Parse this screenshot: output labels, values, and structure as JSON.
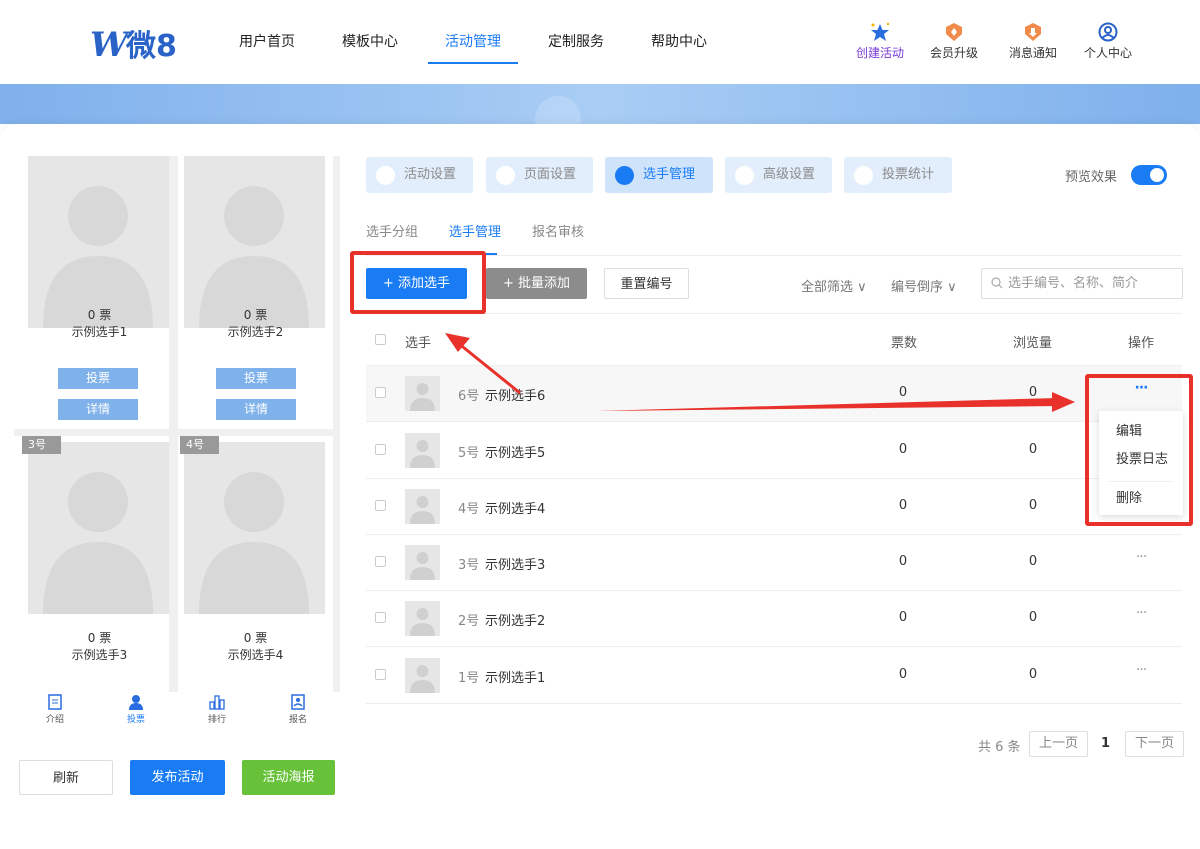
{
  "header": {
    "logo": "W微8",
    "nav": [
      "用户首页",
      "模板中心",
      "活动管理",
      "定制服务",
      "帮助中心"
    ],
    "icons": [
      {
        "label": "创建活动",
        "icon": "stars-icon"
      },
      {
        "label": "会员升级",
        "icon": "badge-icon"
      },
      {
        "label": "消息通知",
        "icon": "bell-badge-icon"
      },
      {
        "label": "个人中心",
        "icon": "user-circle-icon"
      }
    ]
  },
  "preview": {
    "cards": [
      {
        "votes": "0 票",
        "name": "示例选手1",
        "vote_btn": "投票",
        "detail_btn": "详情"
      },
      {
        "votes": "0 票",
        "name": "示例选手2",
        "vote_btn": "投票",
        "detail_btn": "详情"
      },
      {
        "tag": "3号",
        "votes": "0 票",
        "name": "示例选手3"
      },
      {
        "tag": "4号",
        "votes": "0 票",
        "name": "示例选手4"
      }
    ],
    "tabbar": [
      "介绍",
      "投票",
      "排行",
      "报名"
    ],
    "buttons": {
      "refresh": "刷新",
      "publish": "发布活动",
      "poster": "活动海报"
    }
  },
  "settings_tabs": [
    "活动设置",
    "页面设置",
    "选手管理",
    "高级设置",
    "投票统计"
  ],
  "preview_toggle": {
    "label": "预览效果",
    "on": true
  },
  "sub_tabs": [
    "选手分组",
    "选手管理",
    "报名审核"
  ],
  "toolbar": {
    "add": "+ 添加选手",
    "batch": "+ 批量添加",
    "renumber": "重置编号",
    "filter_all": "全部筛选 ∨",
    "sort": "编号倒序 ∨",
    "search_placeholder": "选手编号、名称、简介"
  },
  "table": {
    "headers": {
      "player": "选手",
      "votes": "票数",
      "views": "浏览量",
      "actions": "操作"
    },
    "rows": [
      {
        "num": "6号",
        "name": "示例选手6",
        "votes": "0",
        "views": "0"
      },
      {
        "num": "5号",
        "name": "示例选手5",
        "votes": "0",
        "views": "0"
      },
      {
        "num": "4号",
        "name": "示例选手4",
        "votes": "0",
        "views": "0"
      },
      {
        "num": "3号",
        "name": "示例选手3",
        "votes": "0",
        "views": "0"
      },
      {
        "num": "2号",
        "name": "示例选手2",
        "votes": "0",
        "views": "0"
      },
      {
        "num": "1号",
        "name": "示例选手1",
        "votes": "0",
        "views": "0"
      }
    ],
    "more": "···"
  },
  "row_menu": {
    "edit": "编辑",
    "vote_log": "投票日志",
    "delete": "删除"
  },
  "pagination": {
    "total": "共 6 条",
    "prev": "上一页",
    "current": "1",
    "next": "下一页"
  },
  "colors": {
    "accent": "#1a7cf5",
    "annotation": "#e8312a",
    "poster": "#67c23a",
    "preview_btn": "#7fb1ea"
  }
}
